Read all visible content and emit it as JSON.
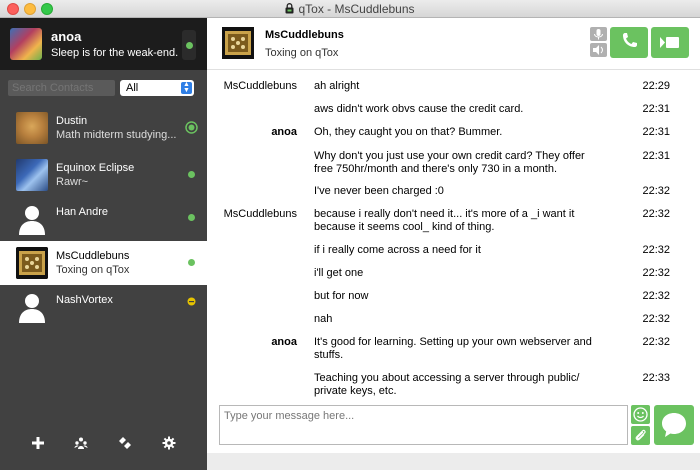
{
  "window": {
    "title": "qTox - MsCuddlebuns"
  },
  "profile": {
    "name": "anoa",
    "status": "Sleep is for the weak-end."
  },
  "search": {
    "placeholder": "Search Contacts"
  },
  "filter": {
    "selected": "All"
  },
  "contacts": [
    {
      "name": "Dustin",
      "status": "Math midterm studying..."
    },
    {
      "name": "Equinox Eclipse",
      "status": "Rawr~"
    },
    {
      "name": "Han Andre",
      "status": ""
    },
    {
      "name": "MsCuddlebuns",
      "status": "Toxing on qTox"
    },
    {
      "name": "NashVortex",
      "status": ""
    }
  ],
  "chat": {
    "contact_name": "MsCuddlebuns",
    "contact_status": "Toxing on qTox",
    "messages": [
      {
        "author": "MsCuddlebuns",
        "text": "ah alright",
        "time": "22:29"
      },
      {
        "author": "",
        "text": "aws didn't work obvs cause the credit card.",
        "time": "22:31"
      },
      {
        "author": "anoa",
        "text": "Oh, they caught you on that? Bummer.",
        "time": "22:31"
      },
      {
        "author": "",
        "text": "Why don't you just use your own credit card? They offer free 750hr/month and there's only 730 in a month.",
        "time": "22:31"
      },
      {
        "author": "",
        "text": "I've never been charged :0",
        "time": "22:32"
      },
      {
        "author": "MsCuddlebuns",
        "text": "because i really don't need it... it's more of a _i want it because it seems cool_ kind of thing.",
        "time": "22:32"
      },
      {
        "author": "",
        "text": "if i really come across a need for it",
        "time": "22:32"
      },
      {
        "author": "",
        "text": "i'll get one",
        "time": "22:32"
      },
      {
        "author": "",
        "text": "but for now",
        "time": "22:32"
      },
      {
        "author": "",
        "text": "nah",
        "time": "22:32"
      },
      {
        "author": "anoa",
        "text": "It's good for learning. Setting up your own webserver and stuffs.",
        "time": "22:32"
      },
      {
        "author": "",
        "text": "Teaching you about accessing a server through public/ private keys, etc.",
        "time": "22:33"
      }
    ]
  },
  "input": {
    "placeholder": "Type your message here..."
  },
  "colors": {
    "accent": "#6bc260",
    "sidebar": "#414141",
    "profile_bg": "#1c1c1c",
    "away": "#e6c300"
  }
}
